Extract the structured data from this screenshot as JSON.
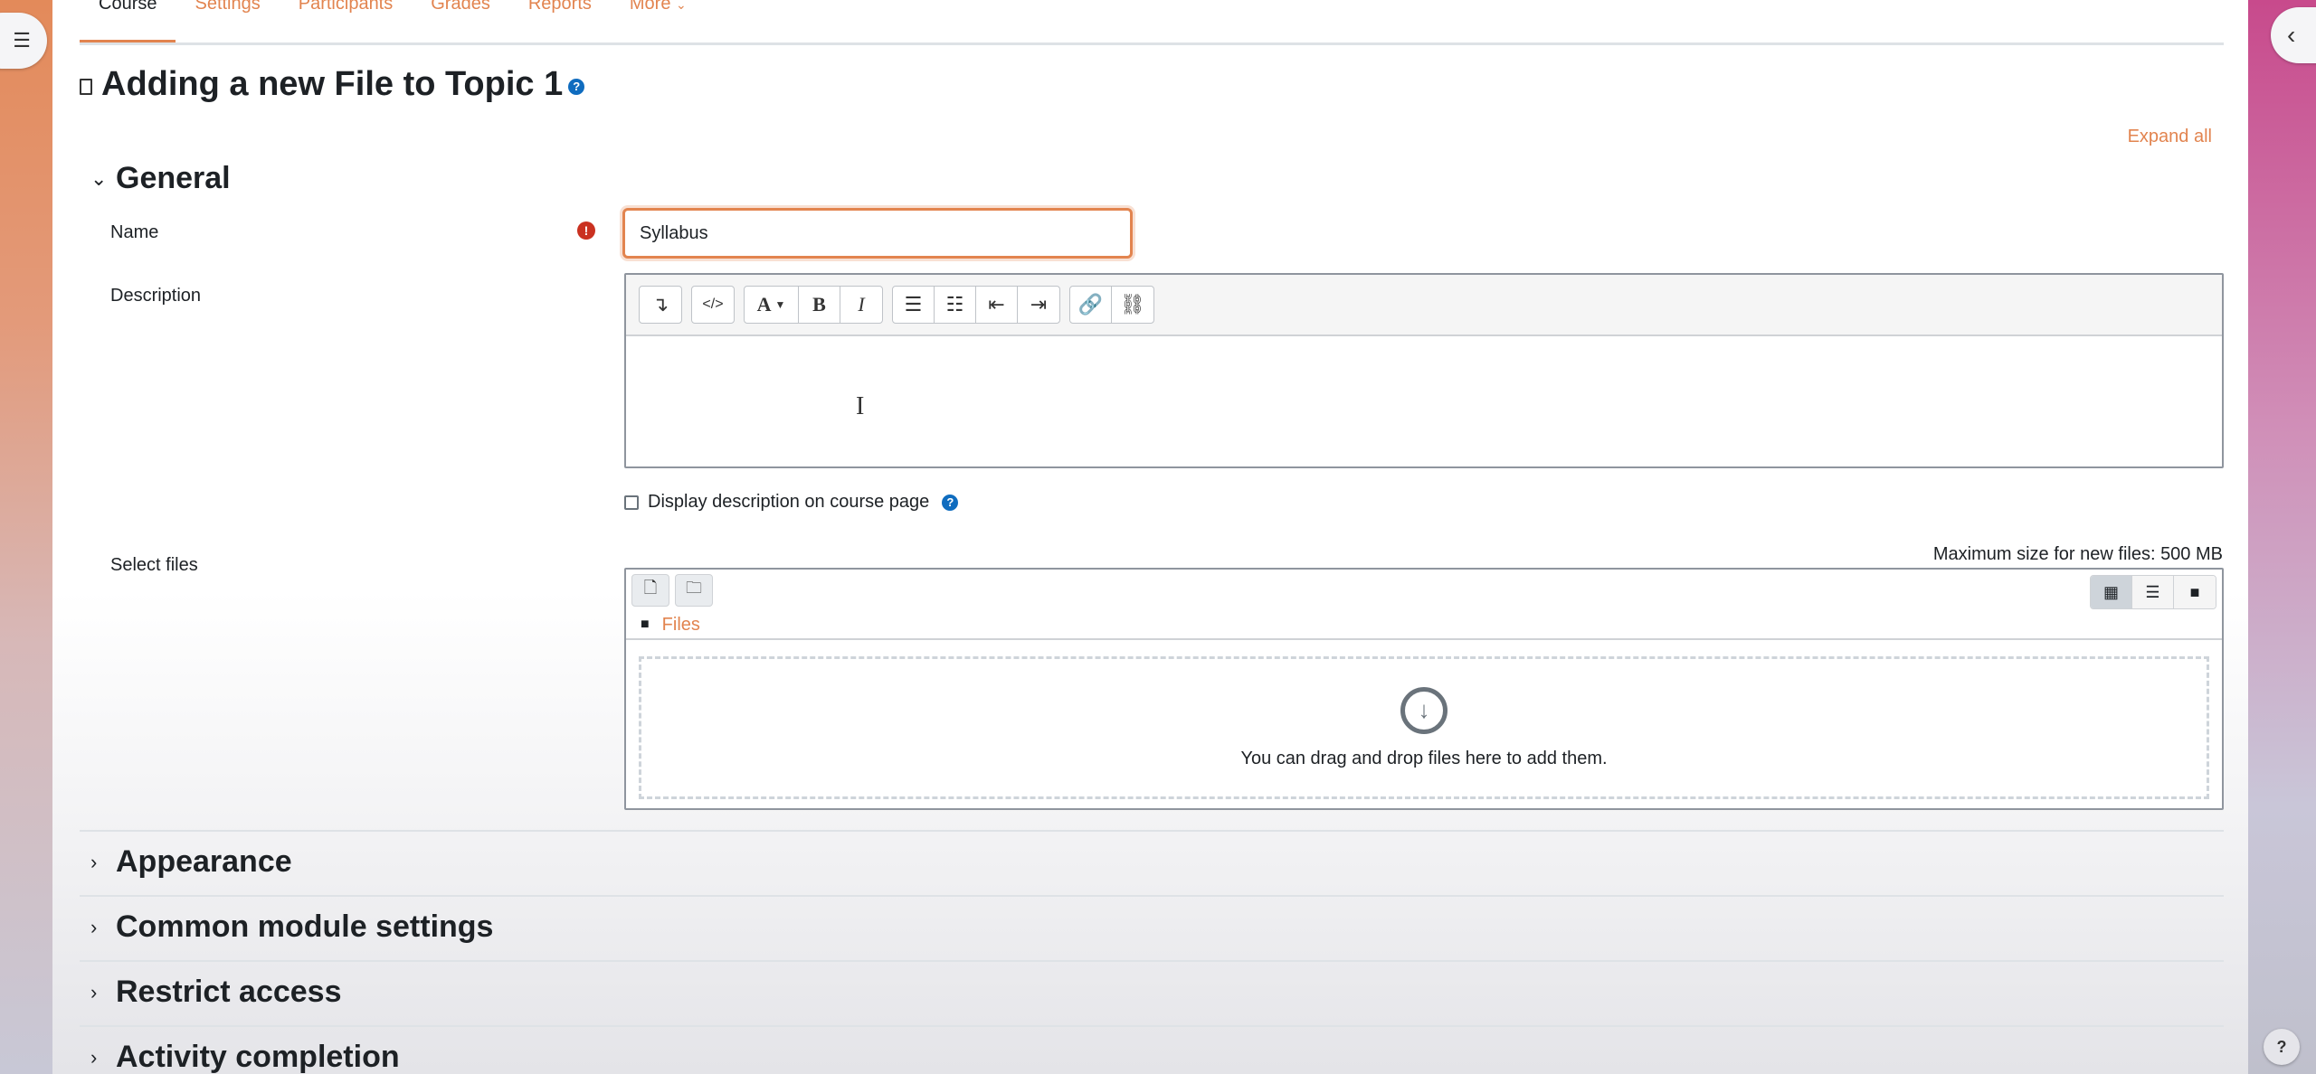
{
  "nav": {
    "tabs": [
      "Course",
      "Settings",
      "Participants",
      "Grades",
      "Reports",
      "More"
    ],
    "active_tab": "Course"
  },
  "page": {
    "title": "Adding a new File to Topic 1",
    "expand_all": "Expand all"
  },
  "general": {
    "heading": "General",
    "name_label": "Name",
    "name_value": "Syllabus",
    "description_label": "Description",
    "display_description_label": "Display description on course page",
    "select_files_label": "Select files",
    "max_size": "Maximum size for new files: 500 MB",
    "files_path": "Files",
    "drop_message": "You can drag and drop files here to add them."
  },
  "toolbar": {
    "font_btn": "A",
    "bold_btn": "B",
    "italic_btn": "I"
  },
  "sections": [
    {
      "label": "Appearance"
    },
    {
      "label": "Common module settings"
    },
    {
      "label": "Restrict access"
    },
    {
      "label": "Activity completion"
    }
  ],
  "help": "?",
  "colors": {
    "accent": "#e2844f",
    "required": "#ca3120",
    "help_icon": "#0f6cbf"
  }
}
